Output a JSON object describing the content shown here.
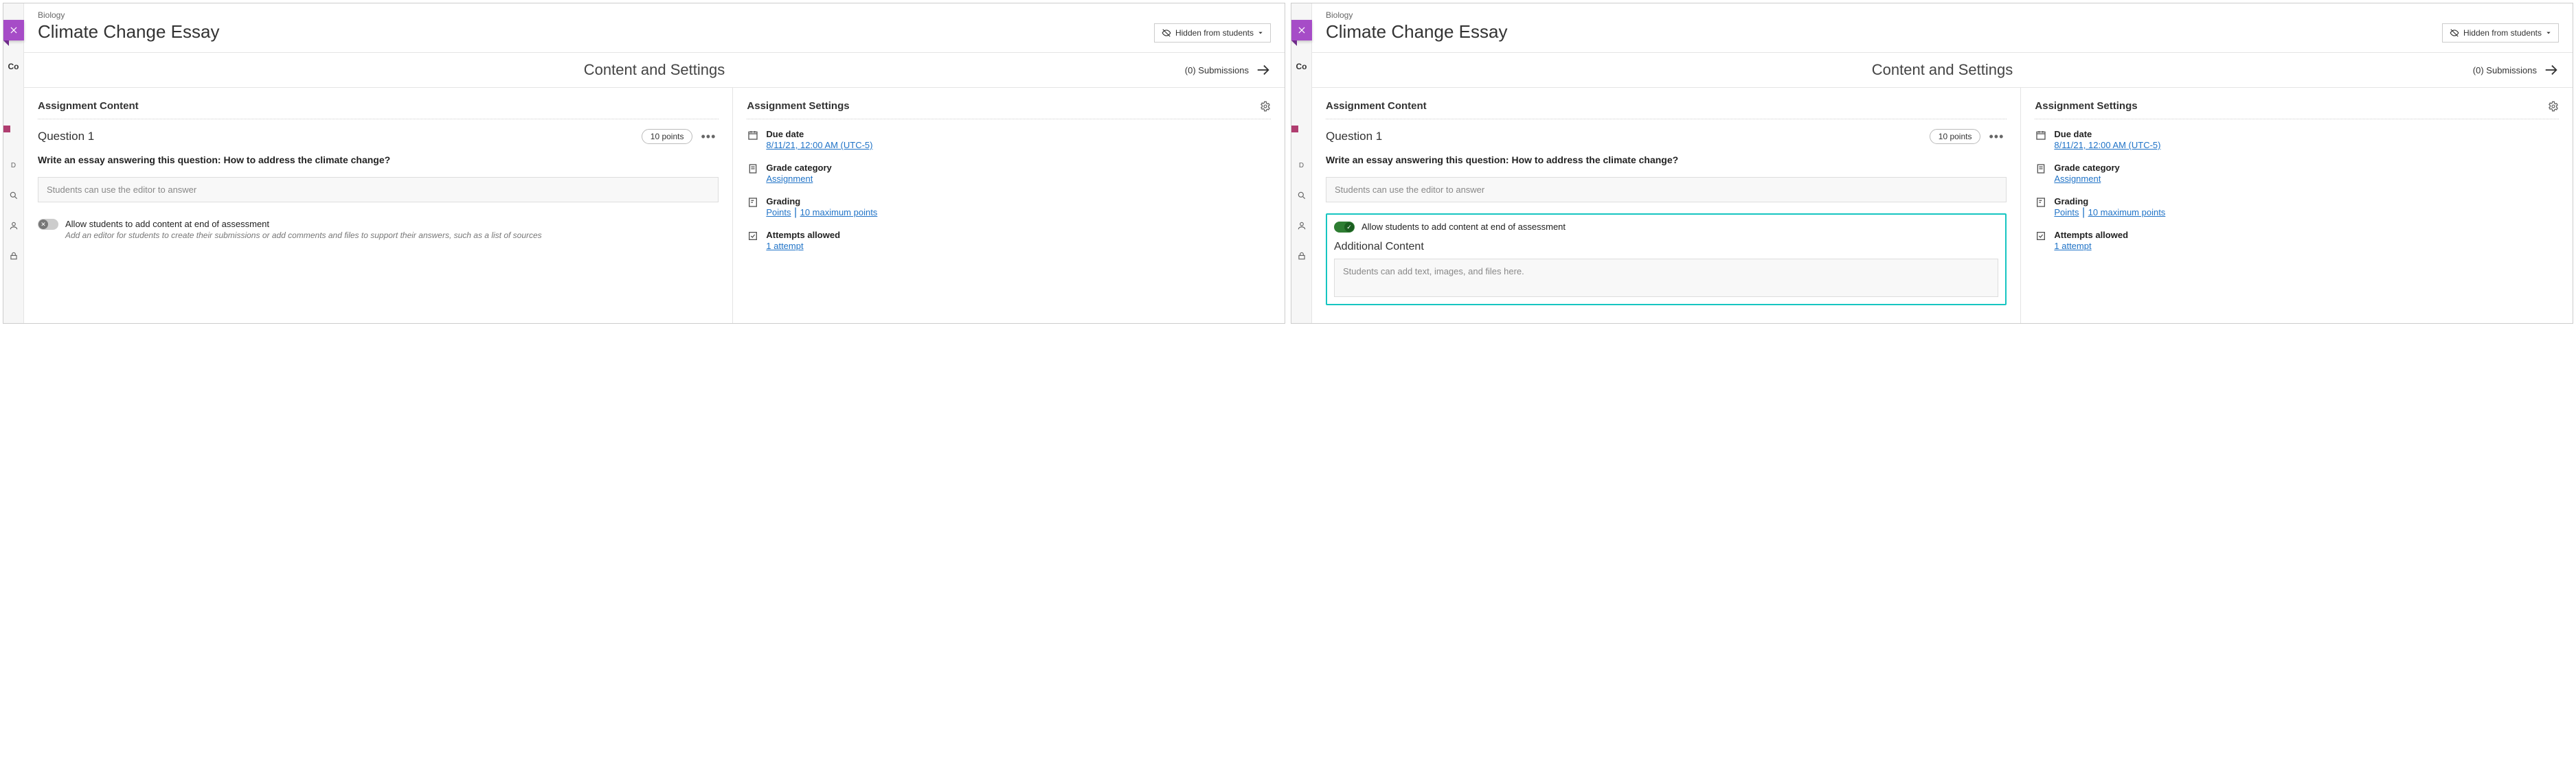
{
  "frames": [
    {
      "course": "Biology",
      "title": "Climate Change Essay",
      "visibility": "Hidden from students",
      "subheader": "Content and Settings",
      "submissions": "(0) Submissions",
      "content_heading": "Assignment Content",
      "question_label": "Question 1",
      "points": "10 points",
      "prompt": "Write an essay answering this question: How to address the climate change?",
      "answer_placeholder": "Students can use the editor to answer",
      "toggle_on": false,
      "toggle_title": "Allow students to add content at end of assessment",
      "toggle_desc": "Add an editor for students to create their submissions or add comments and files to support their answers, such as a list of sources",
      "settings_heading": "Assignment Settings",
      "settings": {
        "due_label": "Due date",
        "due_value": "8/11/21, 12:00 AM (UTC-5)",
        "cat_label": "Grade category",
        "cat_value": "Assignment",
        "grading_label": "Grading",
        "grading_value1": "Points",
        "grading_value2": "10 maximum points",
        "attempts_label": "Attempts allowed",
        "attempts_value": "1 attempt"
      }
    },
    {
      "course": "Biology",
      "title": "Climate Change Essay",
      "visibility": "Hidden from students",
      "subheader": "Content and Settings",
      "submissions": "(0) Submissions",
      "content_heading": "Assignment Content",
      "question_label": "Question 1",
      "points": "10 points",
      "prompt": "Write an essay answering this question: How to address the climate change?",
      "answer_placeholder": "Students can use the editor to answer",
      "toggle_on": true,
      "toggle_title": "Allow students to add content at end of assessment",
      "additional_heading": "Additional Content",
      "additional_placeholder": "Students can add text, images, and files here.",
      "settings_heading": "Assignment Settings",
      "settings": {
        "due_label": "Due date",
        "due_value": "8/11/21, 12:00 AM (UTC-5)",
        "cat_label": "Grade category",
        "cat_value": "Assignment",
        "grading_label": "Grading",
        "grading_value1": "Points",
        "grading_value2": "10 maximum points",
        "attempts_label": "Attempts allowed",
        "attempts_value": "1 attempt"
      }
    }
  ],
  "rail": {
    "co": "Co",
    "d": "D"
  }
}
